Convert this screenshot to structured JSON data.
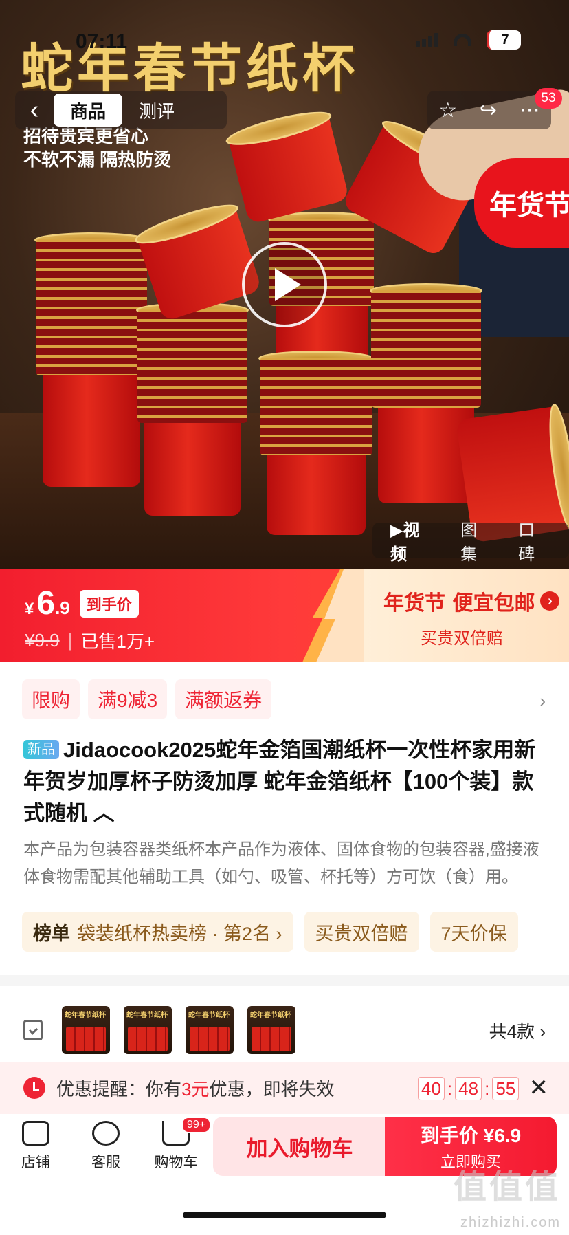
{
  "status_bar": {
    "time": "07:11",
    "battery": "7"
  },
  "hero": {
    "title": "蛇年春节纸杯",
    "subtitle_1": "招待贵宾更省心",
    "subtitle_2": "不软不漏  隔热防烫",
    "tag": "年货节",
    "nav_tabs": [
      "商品",
      "测评"
    ],
    "notification_count": "53",
    "media_tabs": [
      "▶视频",
      "图集",
      "口碑"
    ]
  },
  "price": {
    "currency": "¥",
    "integer": "6",
    "decimal": ".9",
    "chip": "到手价",
    "original": "¥9.9",
    "sold": "已售1万+",
    "promo_title": "年货节 便宜包邮",
    "promo_sub": "买贵双倍赔"
  },
  "promo_tags": [
    "限购",
    "满9减3",
    "满额返券"
  ],
  "product": {
    "badge": "新品",
    "title": "Jidaocook2025蛇年金箔国潮纸杯一次性杯家用新年贺岁加厚杯子防烫加厚 蛇年金箔纸杯【100个装】款式随机 ︿",
    "description": "本产品为包装容器类纸杯本产品作为液体、固体食物的包装容器,盛接液体食物需配其他辅助工具（如勺、吸管、杯托等）方可饮（食）用。"
  },
  "rank": {
    "label": "榜单",
    "text": "袋装纸杯热卖榜 · 第2名 ›",
    "chips": [
      "买贵双倍赔",
      "7天价保"
    ]
  },
  "variants": {
    "thumb_label": "蛇年春节纸杯",
    "count_text": "共4款 ›"
  },
  "coupon": {
    "prefix": "优惠提醒：你有",
    "amount": "3元",
    "suffix": "优惠，即将失效",
    "hours": "40",
    "minutes": "48",
    "seconds": "55"
  },
  "bottom_bar": {
    "shop": "店铺",
    "service": "客服",
    "cart": "购物车",
    "cart_badge": "99+",
    "add_to_cart": "加入购物车",
    "buy_line1": "到手价 ¥6.9",
    "buy_line2": "立即购买"
  },
  "watermark": {
    "main": "值值值",
    "sub": "zhizhizhi.com"
  },
  "colors": {
    "accent": "#ee2434",
    "gold": "#f3cf6e"
  }
}
